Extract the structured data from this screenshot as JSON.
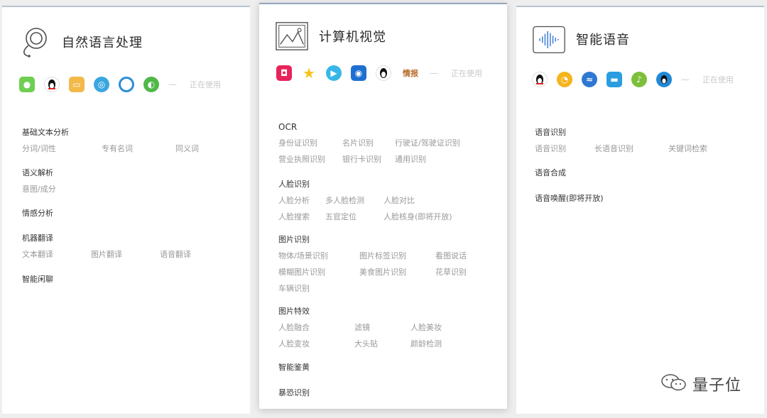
{
  "nlp": {
    "title": "自然语言处理",
    "status": "正在使用",
    "dash": "—",
    "sections": [
      {
        "title": "基础文本分析",
        "items": [
          "分词/词性",
          "专有名词",
          "同义词"
        ]
      },
      {
        "title": "语义解析",
        "items": [
          "意图/成分"
        ]
      },
      {
        "title": "情感分析",
        "items": []
      },
      {
        "title": "机器翻译",
        "items": [
          "文本翻译",
          "图片翻译",
          "语音翻译"
        ]
      },
      {
        "title": "智能闲聊",
        "items": []
      }
    ]
  },
  "cv": {
    "title": "计算机视觉",
    "status": "正在使用",
    "dash": "—",
    "news_app_label": "情报",
    "sections": [
      {
        "title": "OCR",
        "rows": [
          [
            "身份证识别",
            "名片识别",
            "行驶证/驾驶证识别"
          ],
          [
            "营业执照识别",
            "银行卡识别",
            "通用识别"
          ]
        ]
      },
      {
        "title": "人脸识别",
        "rows": [
          [
            "人脸分析",
            "多人脸检测",
            "人脸对比"
          ],
          [
            "人脸搜索",
            "五官定位",
            "人脸核身(即将开放)"
          ]
        ]
      },
      {
        "title": "图片识别",
        "rows": [
          [
            "物体/场景识别",
            "图片标签识别",
            "看图说话"
          ],
          [
            "模糊图片识别",
            "美食图片识别",
            "花草识别"
          ],
          [
            "车辆识别"
          ]
        ]
      },
      {
        "title": "图片特效",
        "rows": [
          [
            "人脸融合",
            "滤镜",
            "人脸美妆"
          ],
          [
            "人脸变妆",
            "大头贴",
            "颜龄检测"
          ]
        ]
      },
      {
        "title": "智能鉴黄",
        "rows": []
      },
      {
        "title": "暴恐识别",
        "rows": []
      }
    ]
  },
  "speech": {
    "title": "智能语音",
    "status": "正在使用",
    "dash": "—",
    "sections": [
      {
        "title": "语音识别",
        "items": [
          "语音识别",
          "长语音识别",
          "关键词检索"
        ]
      },
      {
        "title": "语音合成",
        "items": []
      },
      {
        "title": "语音唤醒(即将开放)",
        "items": []
      }
    ]
  },
  "watermark": {
    "text": "量子位"
  }
}
